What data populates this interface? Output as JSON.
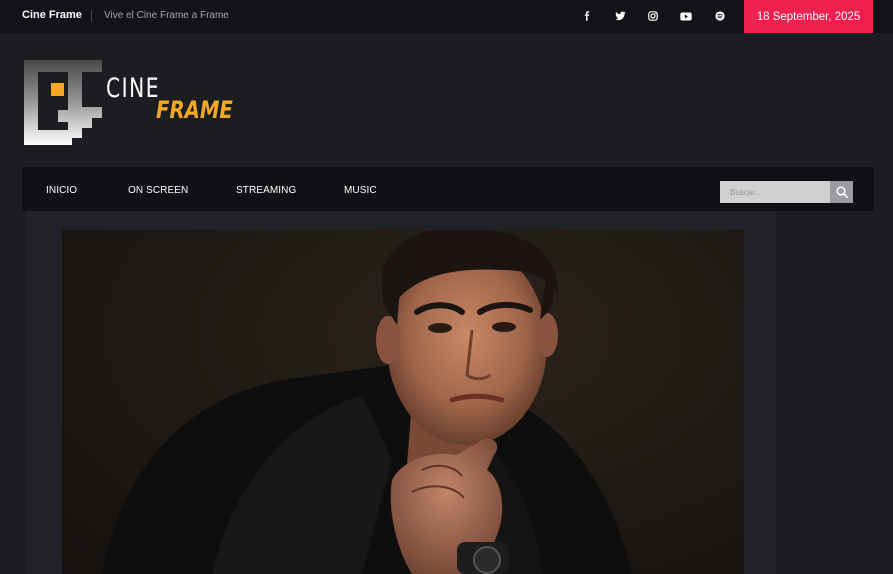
{
  "topbar": {
    "brand": "Cine Frame",
    "tagline": "Vive el Cine Frame a Frame",
    "date": "18 September, 2025",
    "social_icons": [
      "facebook-icon",
      "twitter-icon",
      "instagram-icon",
      "youtube-icon",
      "spotify-icon"
    ]
  },
  "logo": {
    "word_top": "CINE",
    "word_bottom": "FRAME",
    "accent_color": "#f6a822"
  },
  "nav": {
    "items": [
      {
        "label": "INICIO"
      },
      {
        "label": "ON SCREEN"
      },
      {
        "label": "STREAMING"
      },
      {
        "label": "MUSIC"
      }
    ]
  },
  "search": {
    "placeholder": "Buscar...",
    "icon": "search-icon"
  },
  "colors": {
    "date_badge": "#f2204f",
    "background": "#1c1d21",
    "topbar": "#121316",
    "nav": "#101114"
  },
  "featured": {
    "image": "portrait photo of a young man in a black suit, hand on chin"
  }
}
